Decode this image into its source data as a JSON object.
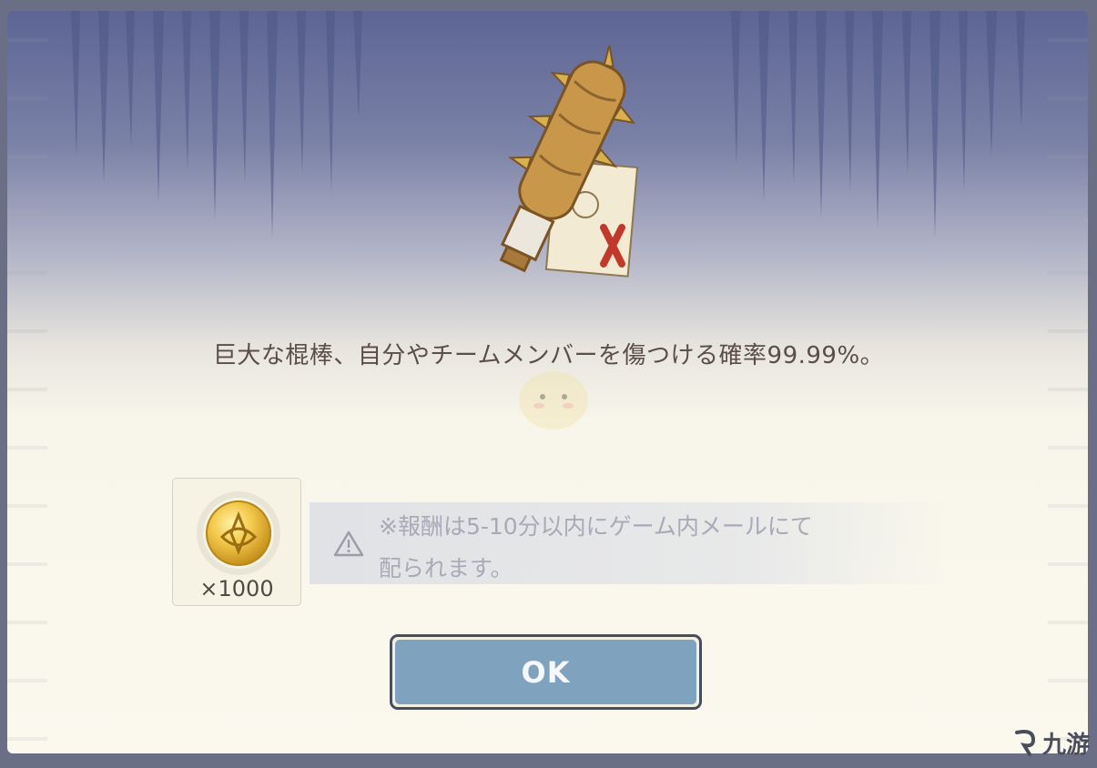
{
  "dialog": {
    "description": "巨大な棍棒、自分やチームメンバーを傷つける確率99.99%。",
    "reward": {
      "icon": "primogem-icon",
      "count_label": "×1000"
    },
    "notice": {
      "icon": "warning-icon",
      "line1": "※報酬は5-10分以内にゲーム内メールにて",
      "line2": "配られます。"
    },
    "ok_button": "OK"
  },
  "watermark": {
    "text": "九游"
  },
  "colors": {
    "header_top": "#5d6594",
    "panel_bg": "#fbf9ee",
    "button_fill": "#7fa3bf",
    "button_border": "#4a4e5c",
    "text": "#5b4d47",
    "notice_text": "#a9a9b8"
  }
}
